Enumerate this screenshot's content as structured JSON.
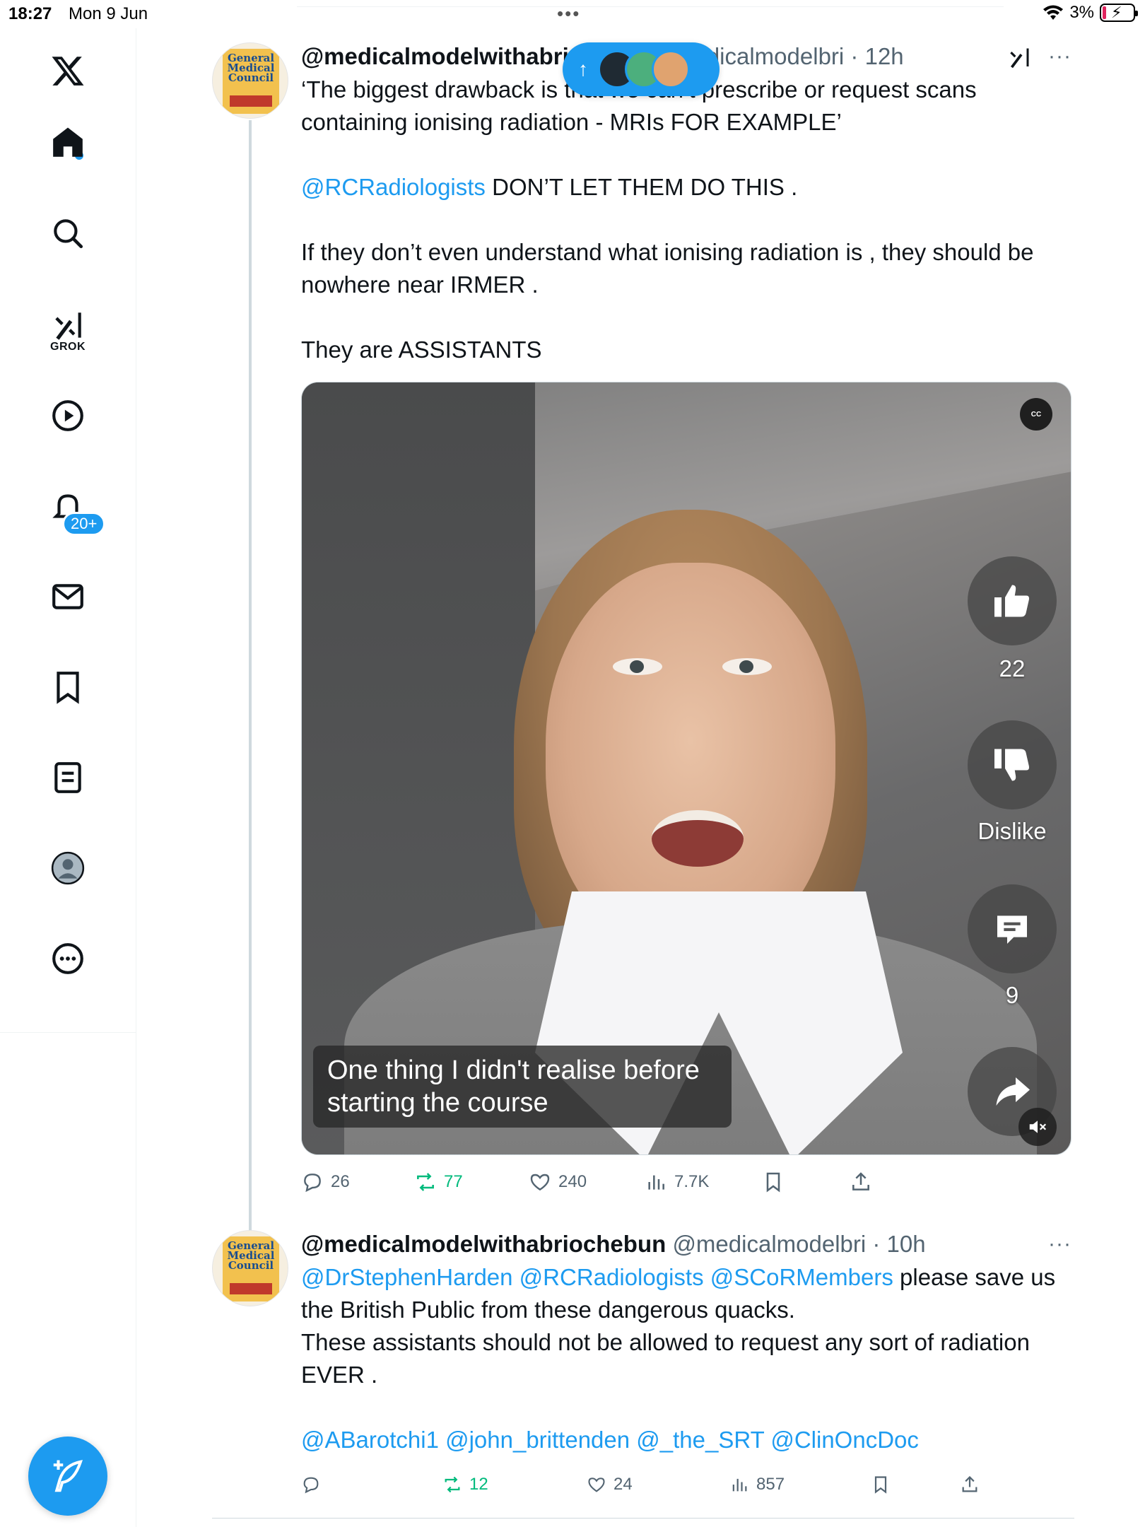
{
  "status_bar": {
    "time": "18:27",
    "date": "Mon 9 Jun",
    "battery": "3%"
  },
  "sidebar": {
    "grok_label": "GROK",
    "notifications_badge": "20+",
    "items": [
      "x-logo",
      "home-icon",
      "search-icon",
      "grok-icon",
      "video-icon",
      "notifications-icon",
      "messages-icon",
      "bookmarks-icon",
      "lists-icon",
      "profile-icon",
      "more-icon"
    ]
  },
  "posts": [
    {
      "display_name": "@medicalmodelwithabri",
      "handle": "@medicalmodelbri",
      "sep": "·",
      "time": "12h",
      "handle_visible": "nedicalmodelbri",
      "paragraphs": [
        "‘The biggest drawback is that we can’t prescribe or request scans containing ionising radiation -  MRIs FOR EXAMPLE’",
        "DON’T LET THEM DO THIS .",
        "If they don’t even understand what ionising radiation is , they should be nowhere near IRMER .",
        "They are ASSISTANTS"
      ],
      "mention": "@RCRadiologists",
      "video": {
        "cc": "CC",
        "like_count": "22",
        "dislike_label": "Dislike",
        "comment_count": "9",
        "caption": "One thing I didn't realise before starting the course"
      },
      "stats": {
        "replies": "26",
        "reposts": "77",
        "likes": "240",
        "views": "7.7K"
      }
    },
    {
      "display_name": "@medicalmodelwithabriochebun",
      "handle": "@medicalmodelbri",
      "sep": "·",
      "time": "10h",
      "mentions_line1": [
        "@DrStephenHarden",
        "@RCRadiologists",
        "@SCoRMembers"
      ],
      "text_after_mentions": "please save us the British Public from these dangerous quacks.",
      "text_line2": "These assistants should not be allowed to request any sort of radiation EVER .",
      "mentions_line2": "@ABarotchi1 @john_brittenden @_the_SRT @ClinOncDoc",
      "stats": {
        "replies": "",
        "reposts": "12",
        "likes": "24",
        "views": "857"
      }
    }
  ],
  "avatar_text": "General Medical Council",
  "colors": {
    "accent": "#1d9bf0",
    "repost": "#00ba7c",
    "secondary_text": "#536471"
  }
}
